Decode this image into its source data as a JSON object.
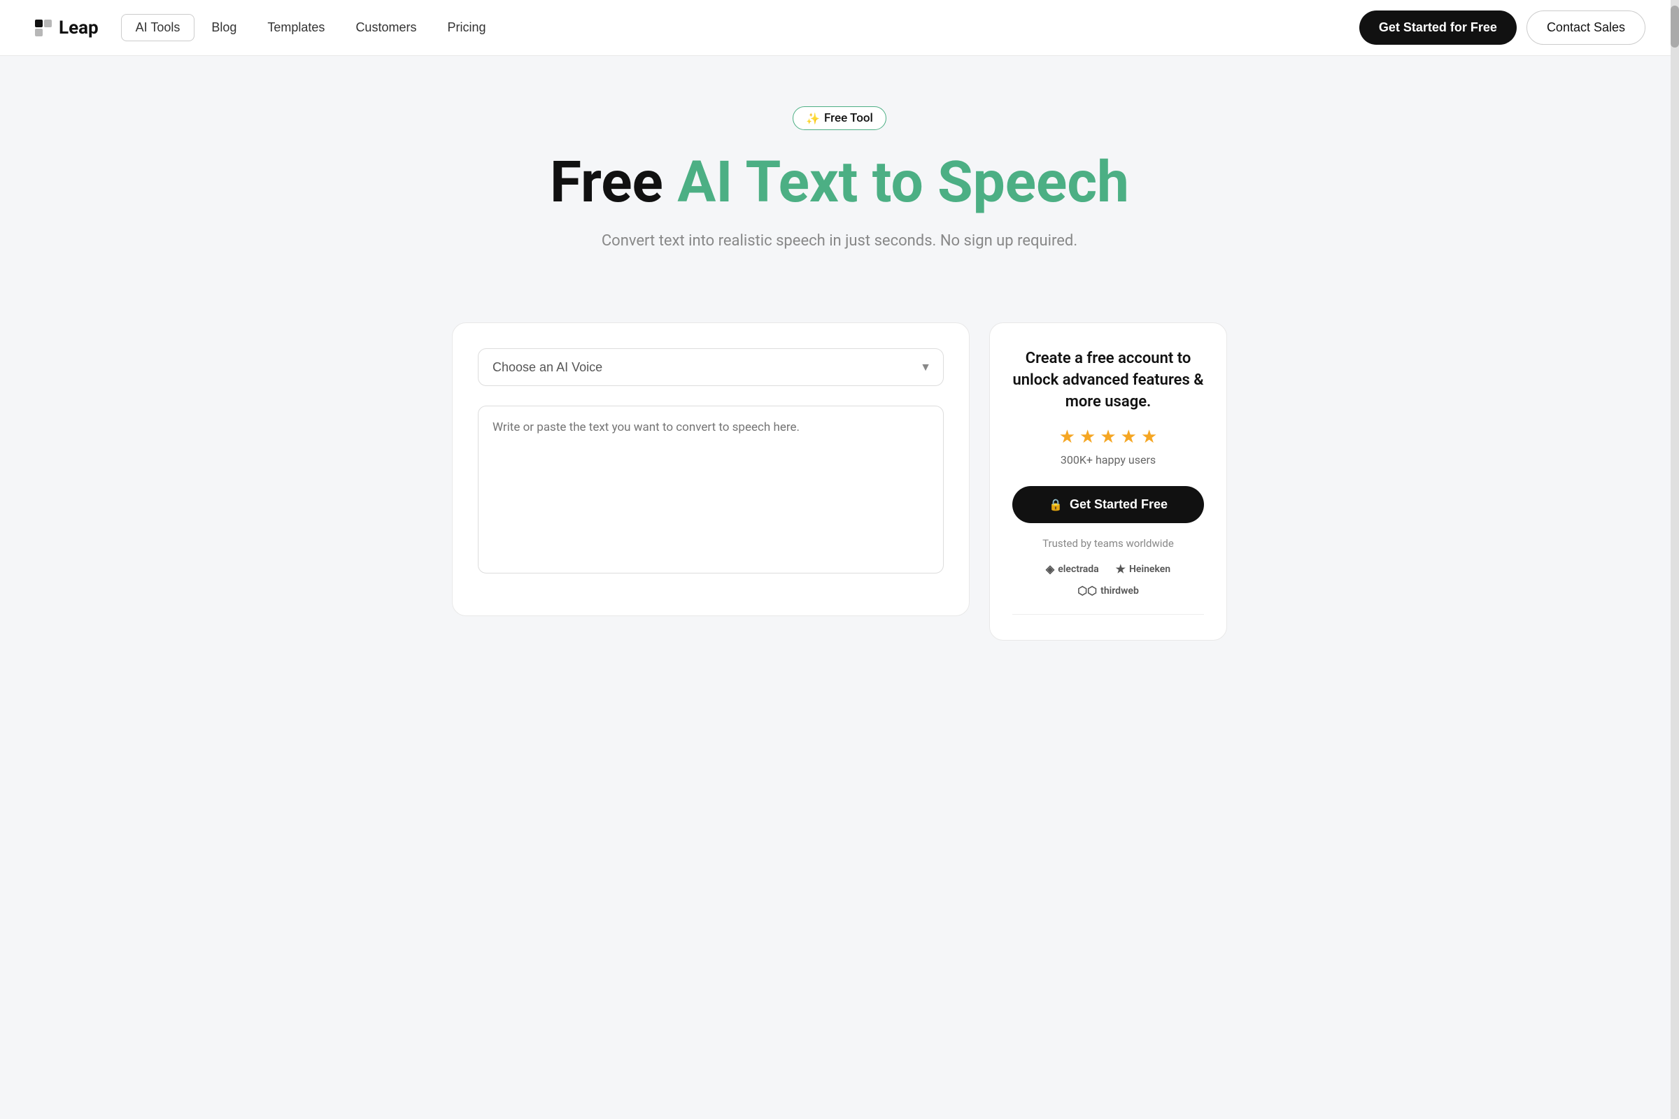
{
  "brand": {
    "name": "Leap",
    "logo_icon": "▣"
  },
  "nav": {
    "items": [
      {
        "label": "AI Tools",
        "active": true
      },
      {
        "label": "Blog",
        "active": false
      },
      {
        "label": "Templates",
        "active": false
      },
      {
        "label": "Customers",
        "active": false
      },
      {
        "label": "Pricing",
        "active": false
      }
    ],
    "cta_primary": "Get Started for Free",
    "cta_secondary": "Contact Sales"
  },
  "hero": {
    "badge_icon": "✨",
    "badge_label": "Free Tool",
    "title_black": "Free",
    "title_teal": "AI Text to Speech",
    "subtitle": "Convert text into realistic speech in just seconds. No sign up required."
  },
  "left_panel": {
    "voice_placeholder": "Choose an AI Voice",
    "text_placeholder": "Write or paste the text you want to convert to speech here."
  },
  "right_panel": {
    "title": "Create a free account to unlock advanced features & more usage.",
    "stars_count": 5,
    "happy_users": "300K+ happy users",
    "cta_label": "Get Started Free",
    "lock_icon": "🔒",
    "trusted_label": "Trusted by teams worldwide",
    "logos": [
      {
        "text": "electrada",
        "prefix": "◈"
      },
      {
        "text": "Heineken",
        "prefix": "★"
      },
      {
        "text": "thirdweb",
        "prefix": "⬡⬡"
      }
    ]
  }
}
